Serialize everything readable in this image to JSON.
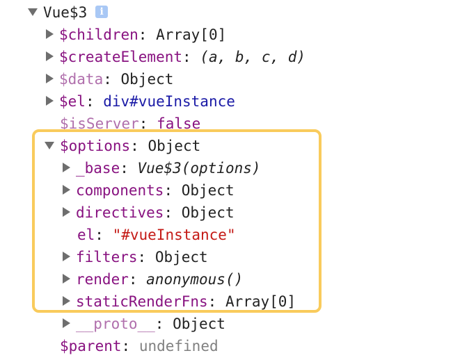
{
  "root": {
    "label": "Vue$3",
    "badge": "i"
  },
  "props": {
    "children": {
      "key": "$children",
      "value": "Array[0]"
    },
    "createElement": {
      "key": "$createElement",
      "value": "(a, b, c, d)"
    },
    "data": {
      "key": "$data",
      "value": "Object"
    },
    "el": {
      "key": "$el",
      "value": "div#vueInstance"
    },
    "isServer": {
      "key": "$isServer",
      "value": "false"
    },
    "options": {
      "key": "$options",
      "value": "Object",
      "base": {
        "key": "_base",
        "value": "Vue$3(options)"
      },
      "components": {
        "key": "components",
        "value": "Object"
      },
      "directives": {
        "key": "directives",
        "value": "Object"
      },
      "el": {
        "key": "el",
        "value": "\"#vueInstance\""
      },
      "filters": {
        "key": "filters",
        "value": "Object"
      },
      "render": {
        "key": "render",
        "value": "anonymous()"
      },
      "staticRenderFns": {
        "key": "staticRenderFns",
        "value": "Array[0]"
      },
      "proto": {
        "key": "__proto__",
        "value": "Object"
      }
    },
    "parent": {
      "key": "$parent",
      "value": "undefined"
    }
  },
  "colors": {
    "key": "#881280",
    "highlight": "#f9cb5c",
    "string": "#c41a16",
    "node": "#1a1aa6"
  }
}
